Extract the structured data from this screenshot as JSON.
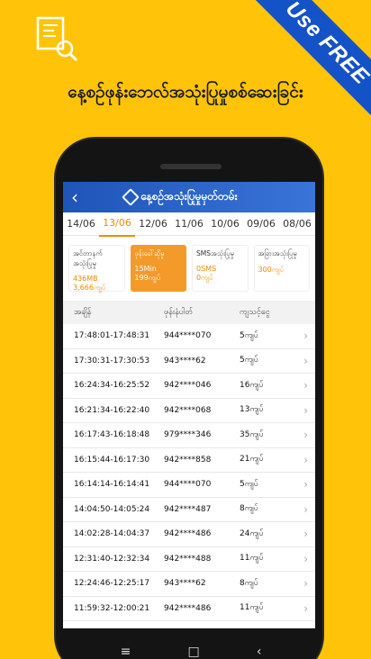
{
  "promo": {
    "ribbon": "Use FREE",
    "headline": "နေ့စဉ်ဖုန်းဘေလ်အသုံးပြုမှုစစ်ဆေးခြင်း"
  },
  "app": {
    "title": "နေ့စဉ်အသုံးပြုမှုမှတ်တမ်း",
    "tabs": [
      "14/06",
      "13/06",
      "12/06",
      "11/06",
      "10/06",
      "09/06",
      "08/06"
    ],
    "active_tab": "13/06",
    "cards": [
      {
        "label": "အင်တာနက်အသုံးပြုမှု",
        "value1": "436MB",
        "value2": "3,666ကျပ်"
      },
      {
        "label": "ဖုန်းခေါ်ဆိုမှု",
        "value1": "15Min",
        "value2": "199ကျပ်"
      },
      {
        "label": "SMSအသုံးပြုမှု",
        "value1": "0SMS",
        "value2": "0ကျပ်"
      },
      {
        "label": "အခြားအသုံးပြုမှု",
        "value1": "",
        "value2": "300ကျပ်"
      }
    ],
    "table": {
      "headers": [
        "အချိန်",
        "ဖုန်းနံပါတ်",
        "ကျသင့်ငွေ"
      ],
      "rows": [
        {
          "time": "17:48:01-17:48:31",
          "number": "944****070",
          "cost": "5ကျပ်"
        },
        {
          "time": "17:30:31-17:30:53",
          "number": "943****62",
          "cost": "5ကျပ်"
        },
        {
          "time": "16:24:34-16:25:52",
          "number": "942****046",
          "cost": "16ကျပ်"
        },
        {
          "time": "16:21:34-16:22:40",
          "number": "942****068",
          "cost": "13ကျပ်"
        },
        {
          "time": "16:17:43-16:18:48",
          "number": "979****346",
          "cost": "35ကျပ်"
        },
        {
          "time": "16:15:44-16:17:30",
          "number": "942****858",
          "cost": "21ကျပ်"
        },
        {
          "time": "16:14:14-16:14:41",
          "number": "944****070",
          "cost": "5ကျပ်"
        },
        {
          "time": "14:04:50-14:05:24",
          "number": "942****487",
          "cost": "8ကျပ်"
        },
        {
          "time": "14:02:28-14:04:37",
          "number": "942****486",
          "cost": "24ကျပ်"
        },
        {
          "time": "12:31:40-12:32:34",
          "number": "942****488",
          "cost": "11ကျပ်"
        },
        {
          "time": "12:24:46-12:25:17",
          "number": "943****62",
          "cost": "8ကျပ်"
        },
        {
          "time": "11:59:32-12:00:21",
          "number": "942****486",
          "cost": "11ကျပ်"
        }
      ]
    }
  },
  "colors": {
    "background": "#FFC40A",
    "ribbon": "#1452C8",
    "accent": "#f08a00",
    "appbar": "#1f54b8"
  }
}
